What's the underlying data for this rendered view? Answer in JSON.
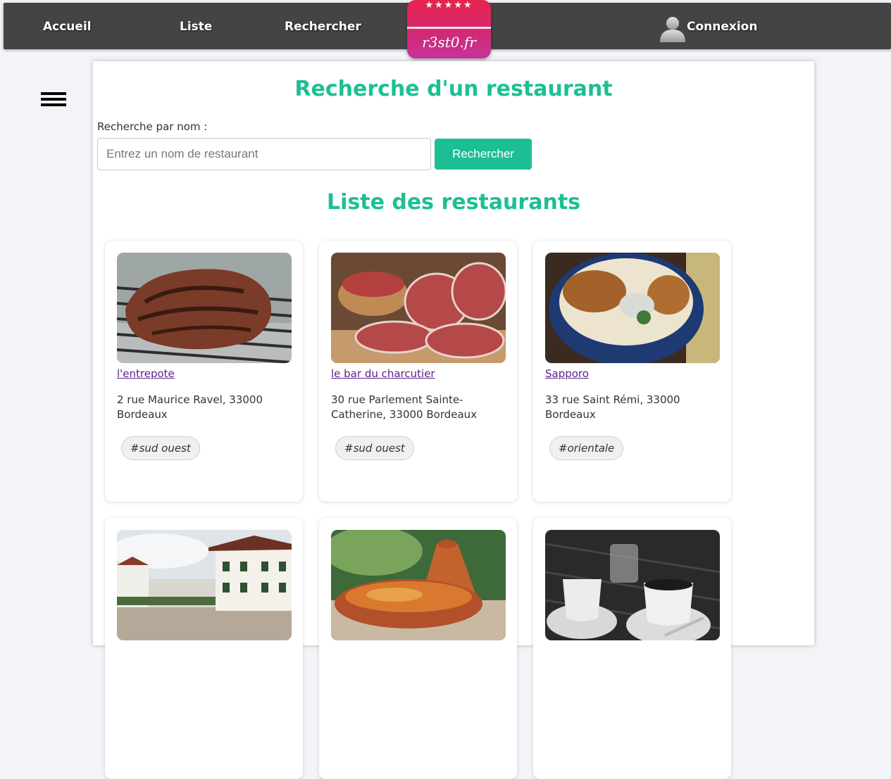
{
  "nav": {
    "home": "Accueil",
    "list": "Liste",
    "search": "Rechercher",
    "login": "Connexion",
    "logo_text": "r3st0.fr",
    "logo_stars": "★★★★★"
  },
  "search": {
    "title": "Recherche d'un restaurant",
    "label": "Recherche par nom :",
    "placeholder": "Entrez un nom de restaurant",
    "button": "Rechercher"
  },
  "list": {
    "title": "Liste des restaurants",
    "restaurants": [
      {
        "name": "l'entrepote",
        "address": "2 rue Maurice Ravel, 33000 Bordeaux",
        "tag": "#sud ouest",
        "image": "grilled-steak"
      },
      {
        "name": "le bar du charcutier",
        "address": "30 rue Parlement Sainte-Catherine, 33000 Bordeaux",
        "tag": "#sud ouest",
        "image": "sliced-saucisson"
      },
      {
        "name": "Sapporo",
        "address": "33 rue Saint Rémi, 33000 Bordeaux",
        "tag": "#orientale",
        "image": "japanese-bowl"
      },
      {
        "name": "",
        "address": "",
        "tag": "",
        "image": "basque-village"
      },
      {
        "name": "",
        "address": "",
        "tag": "",
        "image": "tajine"
      },
      {
        "name": "",
        "address": "",
        "tag": "",
        "image": "coffee-cups"
      }
    ]
  },
  "colors": {
    "accent": "#1cbf95",
    "nav_bg": "#444444",
    "link": "#5c1e8c",
    "logo": "#d12a78"
  }
}
